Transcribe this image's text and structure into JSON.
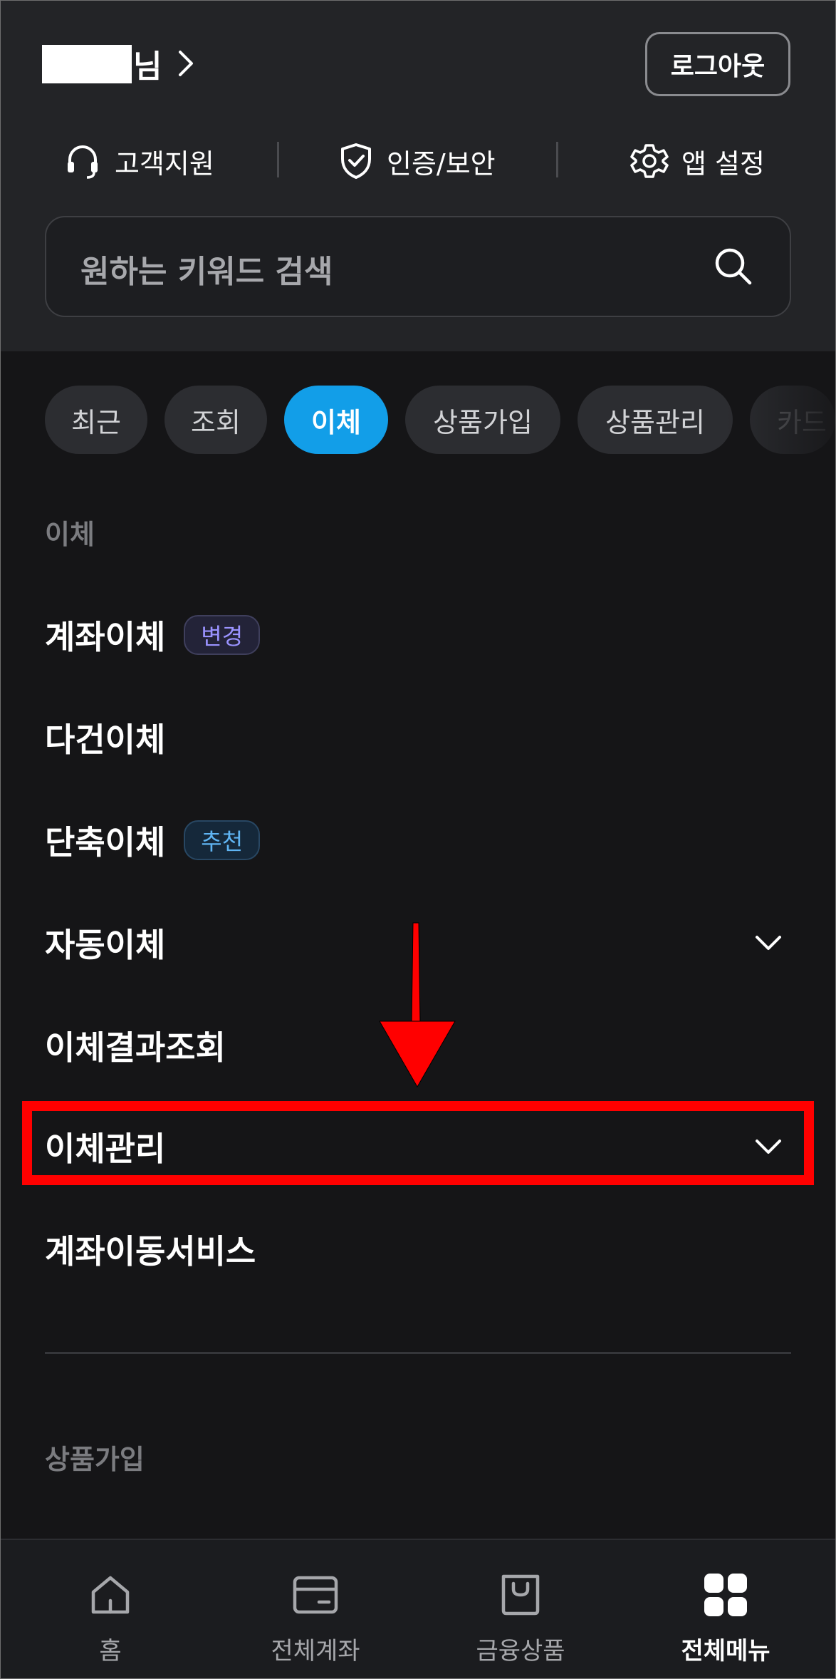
{
  "header": {
    "greeting_suffix": "님",
    "logout_label": "로그아웃",
    "quick_links": [
      {
        "label": "고객지원",
        "icon": "headset-icon"
      },
      {
        "label": "인증/보안",
        "icon": "shield-check-icon"
      },
      {
        "label": "앱 설정",
        "icon": "gear-icon"
      }
    ],
    "search_placeholder": "원하는 키워드 검색"
  },
  "chips": [
    {
      "label": "최근",
      "active": false
    },
    {
      "label": "조회",
      "active": false
    },
    {
      "label": "이체",
      "active": true
    },
    {
      "label": "상품가입",
      "active": false
    },
    {
      "label": "상품관리",
      "active": false
    },
    {
      "label": "카드",
      "active": false
    }
  ],
  "section": {
    "title": "이체",
    "items": [
      {
        "label": "계좌이체",
        "badge": "변경"
      },
      {
        "label": "다건이체"
      },
      {
        "label": "단축이체",
        "badge": "추천"
      },
      {
        "label": "자동이체",
        "expandable": true
      },
      {
        "label": "이체결과조회"
      },
      {
        "label": "이체관리",
        "expandable": true,
        "highlighted": true
      },
      {
        "label": "계좌이동서비스"
      }
    ]
  },
  "next_section": {
    "title": "상품가입"
  },
  "bottom_nav": [
    {
      "label": "홈",
      "icon": "home-icon",
      "active": false
    },
    {
      "label": "전체계좌",
      "icon": "card-icon",
      "active": false
    },
    {
      "label": "금융상품",
      "icon": "shopping-bag-icon",
      "active": false
    },
    {
      "label": "전체메뉴",
      "icon": "grid-menu-icon",
      "active": true
    }
  ],
  "colors": {
    "accent": "#129ee8",
    "highlight": "#ff0000",
    "background": "#151517"
  }
}
